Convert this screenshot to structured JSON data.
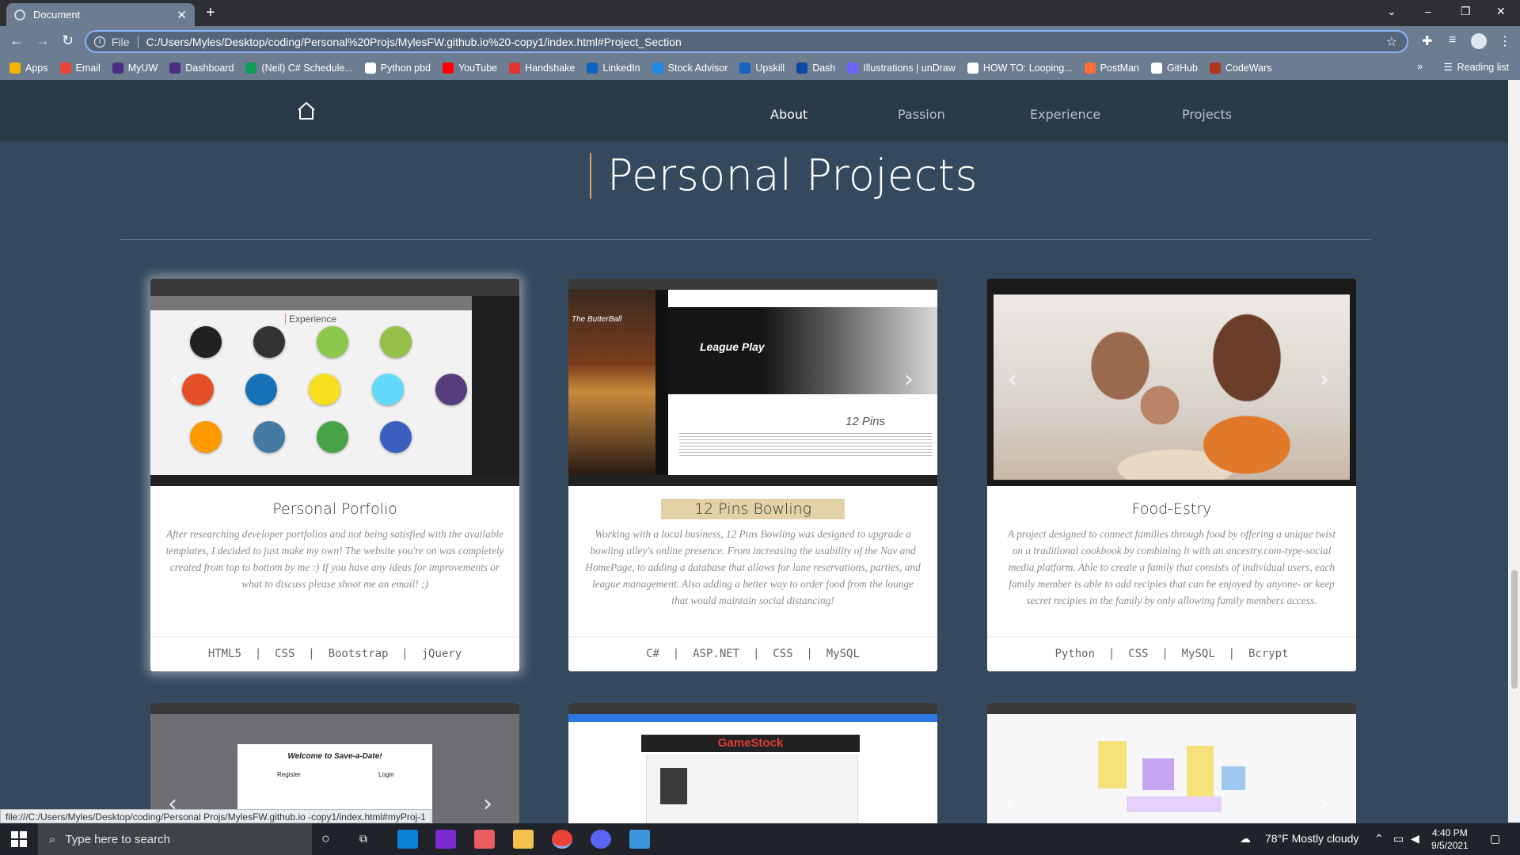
{
  "browser": {
    "tab_title": "Document",
    "tab_close": "✕",
    "new_tab": "+",
    "url_scheme": "File",
    "url": "C:/Users/Myles/Desktop/coding/Personal%20Projs/MylesFW.github.io%20-copy1/index.html#Project_Section",
    "status_url": "file:///C:/Users/Myles/Desktop/coding/Personal Projs/MylesFW.github.io -copy1/index.html#myProj-1",
    "bookmarks": [
      {
        "label": "Apps",
        "color": "#f4b400"
      },
      {
        "label": "Email",
        "color": "#ea4335"
      },
      {
        "label": "MyUW",
        "color": "#4b2e83"
      },
      {
        "label": "Dashboard",
        "color": "#4b2e83"
      },
      {
        "label": "(Neil) C# Schedule...",
        "color": "#0f9d58"
      },
      {
        "label": "Python pbd",
        "color": "#ffffff"
      },
      {
        "label": "YouTube",
        "color": "#ff0000"
      },
      {
        "label": "Handshake",
        "color": "#e3342f"
      },
      {
        "label": "LinkedIn",
        "color": "#0a66c2"
      },
      {
        "label": "Stock Advisor",
        "color": "#1e88e5"
      },
      {
        "label": "Upskill",
        "color": "#1565c0"
      },
      {
        "label": "Dash",
        "color": "#0d47a1"
      },
      {
        "label": "Illustrations | unDraw",
        "color": "#6c63ff"
      },
      {
        "label": "HOW TO: Looping...",
        "color": "#ffffff"
      },
      {
        "label": "PostMan",
        "color": "#ff6c37"
      },
      {
        "label": "GitHub",
        "color": "#ffffff"
      },
      {
        "label": "CodeWars",
        "color": "#b1361e"
      }
    ],
    "reading_list": "Reading list"
  },
  "site_nav": {
    "links": [
      "About",
      "Passion",
      "Experience",
      "Projects"
    ],
    "active": "About"
  },
  "section_title": "Personal Projects",
  "projects": [
    {
      "title": "Personal Porfolio",
      "description": "After researching developer portfolios and not being satisfied with the available templates, I decided to just make my own! The website you're on was completely created from top to bottom by me :) If you have any ideas for improvements or what to discuss please shoot me an email! ;)",
      "tags": [
        "HTML5",
        "CSS",
        "Bootstrap",
        "jQuery"
      ],
      "screenshot_heading": "Experience",
      "screenshot_icons": [
        "python",
        "c",
        "nodejs",
        "shopify",
        "html5",
        "css3",
        "js",
        "react",
        "bootstrap",
        "aws",
        "mysql",
        "mongodb",
        "github"
      ]
    },
    {
      "title": "12 Pins Bowling",
      "description": "Working with a local business, 12 Pins Bowling was designed to upgrade a bowling alley's online presence. From increasing the usability of the Nav and HomePage, to adding a database that allows for lane reservations, parties, and league management. Also adding a better way to order food from the lounge that would maintain social distancing!",
      "tags": [
        "C#",
        "ASP.NET",
        "CSS",
        "MySQL"
      ],
      "screenshot_heading": "League Play",
      "screenshot_sub": "12 Pins",
      "screenshot_side": "The ButterBall"
    },
    {
      "title": "Food-Estry",
      "description": "A project designed to connect families through food by offering a unique twist on a traditional cookbook by combining it with an ancestry.com-type-social media platform. Able to create a family that consists of individual users, each family member is able to add recipies that can be enjoyed by anyone- or keep secret recipies in the family by only allowing family members access.",
      "tags": [
        "Python",
        "CSS",
        "MySQL",
        "Bcrypt"
      ]
    }
  ],
  "second_row": [
    {
      "screenshot_heading": "Welcome to Save-a-Date!",
      "sub": [
        "Register",
        "Login"
      ]
    },
    {
      "screenshot_heading": "GameStock"
    },
    {
      "screenshot_heading": ""
    }
  ],
  "taskbar": {
    "search_placeholder": "Type here to search",
    "weather": "78°F  Mostly cloudy",
    "time": "4:40 PM",
    "date": "9/5/2021"
  }
}
